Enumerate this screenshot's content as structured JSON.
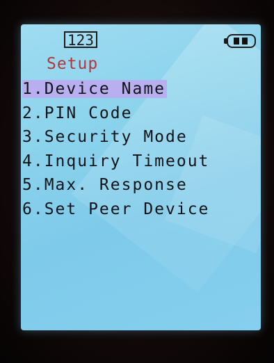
{
  "status": {
    "counter": "123",
    "battery_icon": "battery-icon"
  },
  "screen": {
    "title": "Setup",
    "menu": [
      {
        "label": "1.Device Name",
        "selected": true
      },
      {
        "label": "2.PIN Code",
        "selected": false
      },
      {
        "label": "3.Security Mode",
        "selected": false
      },
      {
        "label": "4.Inquiry Timeout",
        "selected": false
      },
      {
        "label": "5.Max. Response",
        "selected": false
      },
      {
        "label": "6.Set Peer Device",
        "selected": false
      }
    ]
  },
  "colors": {
    "screen_bg": "#8ad2ec",
    "title": "#b2363a",
    "selection_highlight": "#b9aef0",
    "text": "#101418"
  }
}
